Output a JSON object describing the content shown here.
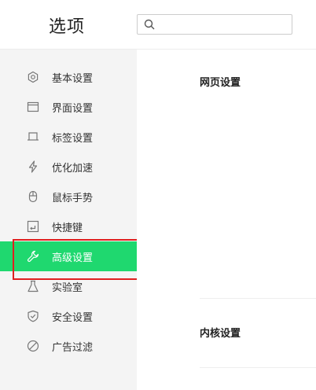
{
  "header": {
    "title": "选项",
    "search_placeholder": ""
  },
  "sidebar": {
    "items": [
      {
        "label": "基本设置",
        "icon": "gear-icon"
      },
      {
        "label": "界面设置",
        "icon": "window-icon"
      },
      {
        "label": "标签设置",
        "icon": "tab-icon"
      },
      {
        "label": "优化加速",
        "icon": "lightning-icon"
      },
      {
        "label": "鼠标手势",
        "icon": "mouse-icon"
      },
      {
        "label": "快捷键",
        "icon": "keyboard-icon"
      },
      {
        "label": "高级设置",
        "icon": "wrench-icon",
        "active": true
      },
      {
        "label": "实验室",
        "icon": "flask-icon"
      },
      {
        "label": "安全设置",
        "icon": "shield-icon"
      },
      {
        "label": "广告过滤",
        "icon": "block-icon"
      }
    ]
  },
  "main": {
    "sections": [
      {
        "title": "网页设置"
      },
      {
        "title": "内核设置"
      }
    ]
  },
  "colors": {
    "accent": "#1fd86f",
    "highlight": "#e02020",
    "sidebar_bg": "#f4f4f4"
  }
}
